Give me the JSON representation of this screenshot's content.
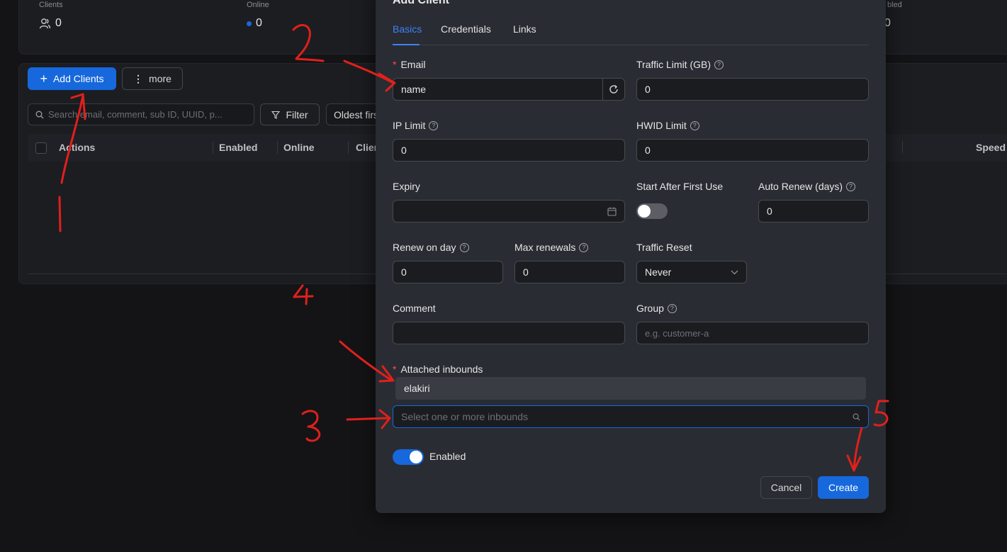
{
  "background": {
    "stats": [
      {
        "label": "Clients",
        "value": "0",
        "icon": "users-icon"
      },
      {
        "label": "Online",
        "value": "0",
        "icon": "online-dot-icon"
      },
      {
        "label": "bled",
        "value": "0"
      }
    ],
    "toolbar": {
      "add_clients_label": "Add Clients",
      "more_label": "more",
      "search_placeholder": "Search email, comment, sub ID, UUID, p...",
      "filter_label": "Filter",
      "sort_label": "Oldest firs"
    },
    "table_headers": [
      "Actions",
      "Enabled",
      "Online",
      "Clien",
      "Speed"
    ]
  },
  "modal": {
    "title": "Add Client",
    "tabs": [
      {
        "label": "Basics",
        "active": true
      },
      {
        "label": "Credentials",
        "active": false
      },
      {
        "label": "Links",
        "active": false
      }
    ],
    "fields": {
      "email": {
        "label": "Email",
        "value": "name",
        "required": true
      },
      "traffic_limit": {
        "label": "Traffic Limit (GB)",
        "value": "0"
      },
      "ip_limit": {
        "label": "IP Limit",
        "value": "0"
      },
      "hwid_limit": {
        "label": "HWID Limit",
        "value": "0"
      },
      "expiry": {
        "label": "Expiry",
        "value": ""
      },
      "start_after_first_use": {
        "label": "Start After First Use",
        "on": false
      },
      "auto_renew": {
        "label": "Auto Renew (days)",
        "value": "0"
      },
      "renew_on_day": {
        "label": "Renew on day",
        "value": "0"
      },
      "max_renewals": {
        "label": "Max renewals",
        "value": "0"
      },
      "traffic_reset": {
        "label": "Traffic Reset",
        "value": "Never"
      },
      "comment": {
        "label": "Comment",
        "value": ""
      },
      "group": {
        "label": "Group",
        "placeholder": "e.g. customer-a"
      },
      "attached_inbounds": {
        "label": "Attached inbounds",
        "required": true,
        "options": [
          "elakiri"
        ],
        "placeholder": "Select one or more inbounds"
      },
      "enabled": {
        "label": "Enabled",
        "on": true
      }
    },
    "buttons": {
      "cancel": "Cancel",
      "create": "Create"
    }
  },
  "annotations": [
    "1",
    "2",
    "3",
    "4",
    "5"
  ],
  "colors": {
    "accent": "#1668dc",
    "annotation": "#e0201c",
    "modal_bg": "#2a2c33",
    "page_bg": "#141416"
  }
}
